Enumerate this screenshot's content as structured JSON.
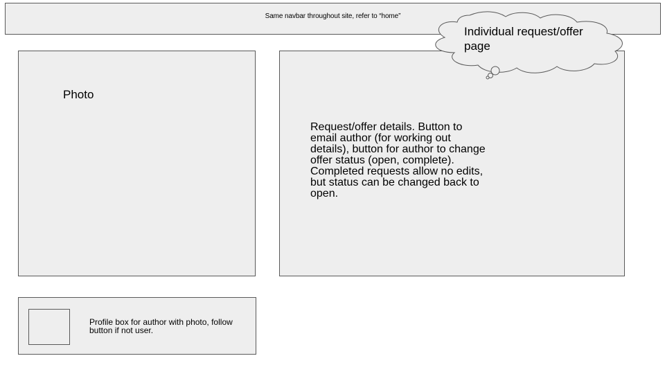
{
  "navbar": {
    "note": "Same navbar throughout site, refer to “home”"
  },
  "photo": {
    "label": "Photo"
  },
  "details": {
    "text": "Request/offer details.  Button to email author (for working out details), button for author to change offer status (open, complete).  Completed requests allow no edits, but status can be changed back to open."
  },
  "profile": {
    "text": "Profile box for author with photo, follow button if not user."
  },
  "callout": {
    "title": "Individual request/offer page"
  },
  "colors": {
    "box_fill": "#eeeeee",
    "box_border": "#595959",
    "background": "#ffffff"
  }
}
